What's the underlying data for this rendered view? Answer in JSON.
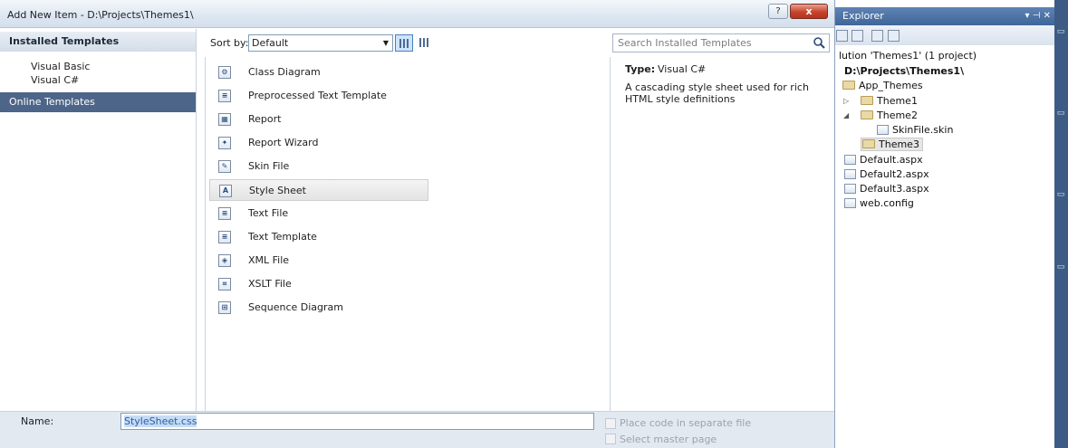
{
  "dialog": {
    "title": "Add New Item - D:\\Projects\\Themes1\\",
    "help_label": "?",
    "close_label": "x"
  },
  "left_pane": {
    "installed_header": "Installed Templates",
    "tree": [
      "Visual Basic",
      "Visual C#"
    ],
    "online": "Online Templates"
  },
  "toolbar": {
    "sort_label": "Sort by:",
    "sort_value": "Default",
    "search_placeholder": "Search Installed Templates"
  },
  "templates": [
    {
      "label": "Class Diagram",
      "icon": "class-diagram-icon",
      "glyph": "⚙"
    },
    {
      "label": "Preprocessed Text Template",
      "icon": "text-template-icon",
      "glyph": "≡"
    },
    {
      "label": "Report",
      "icon": "report-icon",
      "glyph": "▦"
    },
    {
      "label": "Report Wizard",
      "icon": "report-wizard-icon",
      "glyph": "✦"
    },
    {
      "label": "Skin File",
      "icon": "skin-file-icon",
      "glyph": "✎"
    },
    {
      "label": "Style Sheet",
      "icon": "style-sheet-icon",
      "glyph": "A",
      "selected": true
    },
    {
      "label": "Text File",
      "icon": "text-file-icon",
      "glyph": "≡"
    },
    {
      "label": "Text Template",
      "icon": "text-template-icon",
      "glyph": "≡"
    },
    {
      "label": "XML File",
      "icon": "xml-file-icon",
      "glyph": "◈"
    },
    {
      "label": "XSLT File",
      "icon": "xslt-file-icon",
      "glyph": "⌗"
    },
    {
      "label": "Sequence Diagram",
      "icon": "sequence-diagram-icon",
      "glyph": "⊞"
    }
  ],
  "description": {
    "type_key": "Type:",
    "type_value": "Visual C#",
    "text": "A cascading style sheet used for rich HTML style definitions"
  },
  "bottom": {
    "name_label": "Name:",
    "name_value": "StyleSheet.css",
    "checkbox_1": "Place code in separate file",
    "checkbox_2": "Select master page"
  },
  "explorer": {
    "title": "Explorer",
    "controls": "▾ ⊣ ✕",
    "items": [
      "lution 'Themes1' (1 project)",
      "D:\\Projects\\Themes1\\",
      "App_Themes",
      "Theme1",
      "Theme2",
      "SkinFile.skin",
      "Theme3",
      "Default.aspx",
      "Default2.aspx",
      "Default3.aspx",
      "web.config"
    ]
  },
  "colors": {
    "selected_category": "#4d6588",
    "explorer_title": "#3f6699",
    "selection_highlight": "#c6dcf5"
  }
}
